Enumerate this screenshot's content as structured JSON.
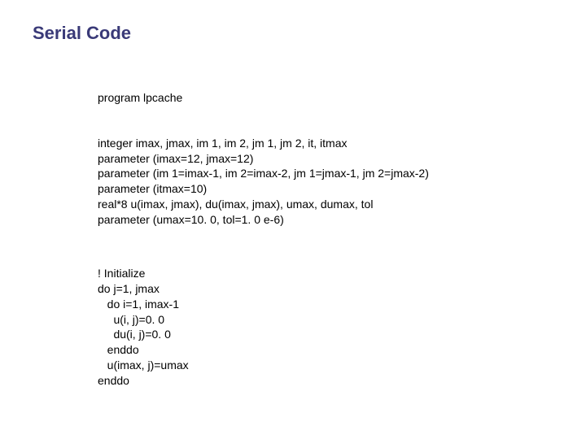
{
  "title": "Serial Code",
  "code": {
    "l1": "program lpcache",
    "l2": "integer imax, jmax, im 1, im 2, jm 1, jm 2, it, itmax",
    "l3": "parameter (imax=12, jmax=12)",
    "l4": "parameter (im 1=imax-1, im 2=imax-2, jm 1=jmax-1, jm 2=jmax-2)",
    "l5": "parameter (itmax=10)",
    "l6": "real*8 u(imax, jmax), du(imax, jmax), umax, dumax, tol",
    "l7": "parameter (umax=10. 0, tol=1. 0 e-6)",
    "l8": "! Initialize",
    "l9": "do j=1, jmax",
    "l10": "   do i=1, imax-1",
    "l11": "     u(i, j)=0. 0",
    "l12": "     du(i, j)=0. 0",
    "l13": "   enddo",
    "l14": "   u(imax, j)=umax",
    "l15": "enddo"
  }
}
